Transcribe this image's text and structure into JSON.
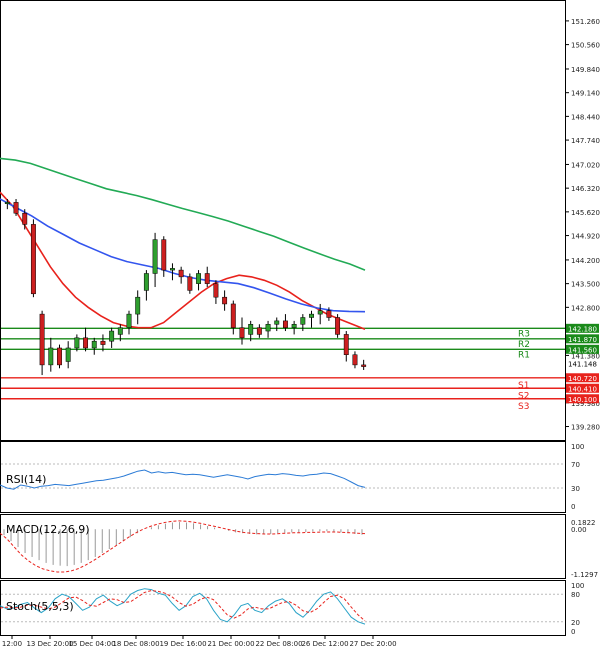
{
  "chart_data": {
    "type": "candlestick",
    "timeframe_labels": [
      "12:00",
      "13 Dec 20:00",
      "15 Dec 04:00",
      "18 Dec 08:00",
      "19 Dec 16:00",
      "21 Dec 00:00",
      "22 Dec 08:00",
      "26 Dec 12:00",
      "27 Dec 20:00"
    ],
    "price_axis": {
      "ticks": [
        "151.260",
        "150.560",
        "149.840",
        "149.140",
        "148.440",
        "147.740",
        "147.020",
        "146.320",
        "145.620",
        "144.920",
        "144.200",
        "143.500",
        "142.800",
        "141.380",
        "139.980",
        "139.280"
      ],
      "range": [
        139.0,
        151.7
      ]
    },
    "candles": [
      [
        145.86,
        146.0,
        145.7,
        145.9
      ],
      [
        145.9,
        146.0,
        145.5,
        145.58
      ],
      [
        145.58,
        145.7,
        145.1,
        145.25
      ],
      [
        145.25,
        145.4,
        143.1,
        143.2
      ],
      [
        142.6,
        142.7,
        140.8,
        141.1
      ],
      [
        141.1,
        141.9,
        140.9,
        141.6
      ],
      [
        141.6,
        141.7,
        141.0,
        141.1
      ],
      [
        141.2,
        141.8,
        141.0,
        141.6
      ],
      [
        141.6,
        142.0,
        141.5,
        141.9
      ],
      [
        141.9,
        142.2,
        141.5,
        141.6
      ],
      [
        141.6,
        141.9,
        141.4,
        141.8
      ],
      [
        141.8,
        142.0,
        141.5,
        141.7
      ],
      [
        141.8,
        142.2,
        141.6,
        142.1
      ],
      [
        142.0,
        142.3,
        141.8,
        142.2
      ],
      [
        142.2,
        142.7,
        142.0,
        142.6
      ],
      [
        142.6,
        143.3,
        142.3,
        143.1
      ],
      [
        143.3,
        143.9,
        143.0,
        143.8
      ],
      [
        143.8,
        145.0,
        143.4,
        144.8
      ],
      [
        144.8,
        144.9,
        143.7,
        143.9
      ],
      [
        143.9,
        144.1,
        143.6,
        143.95
      ],
      [
        143.9,
        144.0,
        143.5,
        143.7
      ],
      [
        143.7,
        143.8,
        143.2,
        143.3
      ],
      [
        143.5,
        143.9,
        143.3,
        143.8
      ],
      [
        143.8,
        144.0,
        143.4,
        143.5
      ],
      [
        143.5,
        143.6,
        142.9,
        143.1
      ],
      [
        143.1,
        143.3,
        142.7,
        142.9
      ],
      [
        142.9,
        143.0,
        142.0,
        142.2
      ],
      [
        142.2,
        142.5,
        141.7,
        141.9
      ],
      [
        142.0,
        142.4,
        141.8,
        142.3
      ],
      [
        142.2,
        142.3,
        141.9,
        142.0
      ],
      [
        142.1,
        142.4,
        141.9,
        142.3
      ],
      [
        142.3,
        142.5,
        142.1,
        142.4
      ],
      [
        142.4,
        142.6,
        142.1,
        142.2
      ],
      [
        142.2,
        142.4,
        142.0,
        142.3
      ],
      [
        142.3,
        142.6,
        142.1,
        142.5
      ],
      [
        142.5,
        142.7,
        142.2,
        142.6
      ],
      [
        142.6,
        142.9,
        142.3,
        142.7
      ],
      [
        142.7,
        142.8,
        142.4,
        142.5
      ],
      [
        142.5,
        142.6,
        141.9,
        142.0
      ],
      [
        142.0,
        142.1,
        141.2,
        141.4
      ],
      [
        141.4,
        141.5,
        141.0,
        141.1
      ],
      [
        141.1,
        141.25,
        140.95,
        141.05
      ]
    ],
    "moving_averages": [
      {
        "color": "#e8221c",
        "values": [
          146.2,
          145.8,
          145.2,
          144.6,
          144.0,
          143.5,
          143.1,
          142.8,
          142.55,
          142.35,
          142.25,
          142.2,
          142.2,
          142.35,
          142.65,
          142.95,
          143.25,
          143.5,
          143.65,
          143.75,
          143.7,
          143.6,
          143.45,
          143.25,
          143.0,
          142.8,
          142.6,
          142.45,
          142.3,
          142.15
        ]
      },
      {
        "color": "#3355ee",
        "values": [
          146.0,
          145.75,
          145.5,
          145.2,
          144.95,
          144.7,
          144.5,
          144.3,
          144.15,
          144.05,
          143.95,
          143.8,
          143.68,
          143.6,
          143.55,
          143.5,
          143.38,
          143.22,
          143.05,
          142.9,
          142.78,
          142.7,
          142.68,
          142.67
        ]
      },
      {
        "color": "#22aa55",
        "values": [
          147.2,
          147.15,
          147.05,
          146.9,
          146.75,
          146.6,
          146.45,
          146.3,
          146.2,
          146.1,
          145.98,
          145.85,
          145.72,
          145.6,
          145.48,
          145.35,
          145.2,
          145.05,
          144.9,
          144.72,
          144.55,
          144.38,
          144.22,
          144.08,
          143.9
        ]
      }
    ],
    "levels": [
      {
        "label": "R3",
        "value": 142.18,
        "value_label": "142.180",
        "color": "#1a8a1a"
      },
      {
        "label": "R2",
        "value": 141.87,
        "value_label": "141.870",
        "color": "#1a8a1a"
      },
      {
        "label": "R1",
        "value": 141.56,
        "value_label": "141.560",
        "color": "#1a8a1a"
      },
      {
        "label": "S1",
        "value": 140.72,
        "value_label": "140.720",
        "color": "#e8221c"
      },
      {
        "label": "S2",
        "value": 140.41,
        "value_label": "140.410",
        "color": "#e8221c"
      },
      {
        "label": "S3",
        "value": 140.1,
        "value_label": "140.100",
        "color": "#e8221c"
      }
    ],
    "current_price": {
      "value": 141.148,
      "label": "141.148"
    },
    "indicators": {
      "rsi": {
        "label": "RSI(14)",
        "ticks": [
          "100",
          "70",
          "30",
          "0"
        ],
        "values": [
          35,
          30,
          28,
          35,
          33,
          30,
          33,
          34,
          36,
          35,
          34,
          36,
          38,
          40,
          42,
          43,
          45,
          47,
          50,
          54,
          58,
          60,
          55,
          57,
          55,
          56,
          54,
          52,
          53,
          52,
          50,
          48,
          50,
          52,
          50,
          48,
          45,
          49,
          51,
          53,
          52,
          54,
          53,
          51,
          50,
          52,
          53,
          55,
          54,
          50,
          46,
          40,
          34,
          31
        ]
      },
      "macd": {
        "label": "MACD(12,26,9)",
        "ticks": [
          "0.1822",
          "0.00",
          "-1.1297"
        ],
        "histogram": [
          -0.15,
          -0.3,
          -0.45,
          -0.6,
          -0.7,
          -0.78,
          -0.85,
          -0.9,
          -0.92,
          -0.93,
          -0.9,
          -0.85,
          -0.78,
          -0.7,
          -0.6,
          -0.5,
          -0.4,
          -0.3,
          -0.2,
          -0.1,
          0.0,
          0.05,
          0.1,
          0.14,
          0.17,
          0.18,
          0.17,
          0.15,
          0.12,
          0.08,
          0.04,
          0.0,
          -0.04,
          -0.08,
          -0.1,
          -0.12,
          -0.13,
          -0.13,
          -0.12,
          -0.1,
          -0.09,
          -0.08,
          -0.08,
          -0.07,
          -0.06,
          -0.05,
          -0.05,
          -0.06,
          -0.08,
          -0.1,
          -0.12,
          -0.14
        ],
        "signal": [
          -0.1,
          -0.25,
          -0.45,
          -0.65,
          -0.8,
          -0.92,
          -1.0,
          -1.05,
          -1.08,
          -1.08,
          -1.05,
          -0.99,
          -0.9,
          -0.8,
          -0.68,
          -0.56,
          -0.44,
          -0.32,
          -0.2,
          -0.09,
          0.0,
          0.07,
          0.13,
          0.17,
          0.2,
          0.21,
          0.2,
          0.18,
          0.15,
          0.11,
          0.07,
          0.03,
          -0.01,
          -0.05,
          -0.08,
          -0.1,
          -0.11,
          -0.12,
          -0.12,
          -0.11,
          -0.1,
          -0.09,
          -0.09,
          -0.08,
          -0.08,
          -0.07,
          -0.07,
          -0.07,
          -0.08,
          -0.09,
          -0.1,
          -0.11
        ]
      },
      "stoch": {
        "label": "Stoch(5,5,3)",
        "ticks": [
          "100",
          "80",
          "20",
          "0"
        ],
        "k": [
          55,
          48,
          50,
          58,
          62,
          50,
          40,
          50,
          70,
          80,
          75,
          60,
          45,
          52,
          70,
          78,
          65,
          55,
          62,
          80,
          88,
          92,
          90,
          82,
          78,
          60,
          45,
          55,
          75,
          82,
          70,
          45,
          25,
          20,
          35,
          55,
          60,
          45,
          40,
          55,
          65,
          70,
          60,
          40,
          30,
          45,
          65,
          80,
          85,
          70,
          50,
          30,
          20,
          15
        ],
        "d": [
          50,
          52,
          50,
          52,
          56,
          56,
          52,
          48,
          52,
          62,
          72,
          74,
          66,
          56,
          54,
          62,
          70,
          68,
          62,
          64,
          74,
          84,
          88,
          86,
          82,
          74,
          62,
          54,
          58,
          68,
          74,
          68,
          52,
          35,
          28,
          35,
          48,
          52,
          48,
          48,
          55,
          62,
          64,
          56,
          44,
          40,
          48,
          62,
          75,
          78,
          70,
          52,
          35,
          22
        ]
      }
    }
  }
}
